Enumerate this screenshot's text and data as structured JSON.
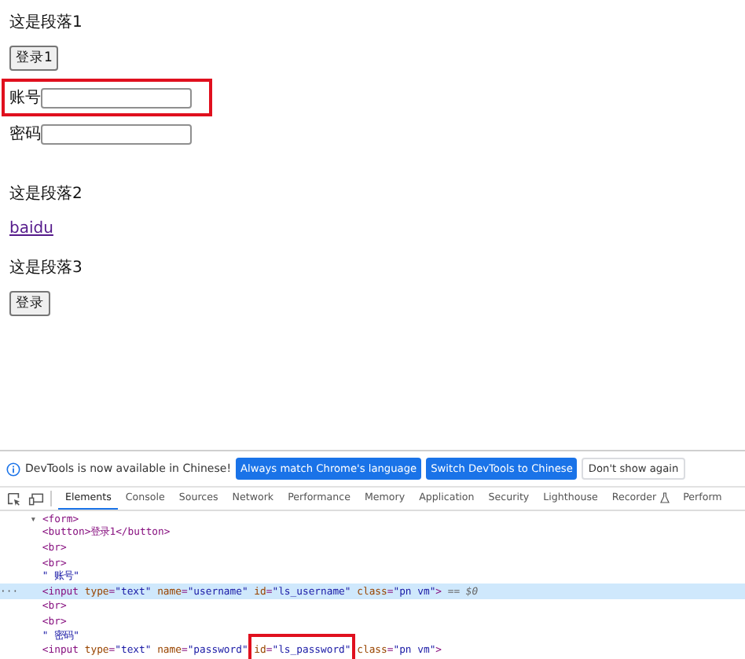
{
  "page": {
    "content": [
      {
        "kind": "paragraph",
        "text": "这是段落1"
      },
      {
        "kind": "button",
        "text": "登录1"
      },
      {
        "kind": "field",
        "label": "账号",
        "boxed": true
      },
      {
        "kind": "field",
        "label": "密码",
        "boxed": false
      },
      {
        "kind": "gap"
      },
      {
        "kind": "paragraph",
        "text": "这是段落2"
      },
      {
        "kind": "link",
        "text": "baidu"
      },
      {
        "kind": "paragraph",
        "text": "这是段落3"
      },
      {
        "kind": "button",
        "text": "登录"
      }
    ]
  },
  "devtools": {
    "infobar": {
      "message": "DevTools is now available in Chinese!",
      "buttons": [
        "Always match Chrome's language",
        "Switch DevTools to Chinese"
      ],
      "dismiss": "Don't show again"
    },
    "tabs": [
      {
        "label": "Elements",
        "selected": true
      },
      {
        "label": "Console",
        "selected": false
      },
      {
        "label": "Sources",
        "selected": false
      },
      {
        "label": "Network",
        "selected": false
      },
      {
        "label": "Performance",
        "selected": false
      },
      {
        "label": "Memory",
        "selected": false
      },
      {
        "label": "Application",
        "selected": false
      },
      {
        "label": "Security",
        "selected": false
      },
      {
        "label": "Lighthouse",
        "selected": false
      },
      {
        "label": "Recorder",
        "selected": false,
        "flask": true
      },
      {
        "label": "Perform",
        "selected": false
      }
    ],
    "tree": [
      {
        "expander": "▾",
        "parts": [
          {
            "text": "<form>",
            "boxed": false
          }
        ],
        "selected": false,
        "children": [
          {
            "parts": [
              {
                "text": "<button>登录1</button>",
                "boxed": false
              }
            ],
            "selected": false
          },
          {
            "parts": [
              {
                "text": "<br>",
                "boxed": false
              }
            ],
            "selected": false
          },
          {
            "parts": [
              {
                "text": "<br>",
                "boxed": false
              }
            ],
            "selected": false
          },
          {
            "parts": [
              {
                "text": "\" 账号\"",
                "boxed": false
              }
            ],
            "selected": false
          },
          {
            "parts": [
              {
                "text": "<input type=\"text\" name=\"username\" id=\"ls_username\" class=\"pn vm\">",
                "boxed": false
              }
            ],
            "suffix": "== $0",
            "gutter": "···",
            "selected": true
          },
          {
            "parts": [
              {
                "text": "<br>",
                "boxed": false
              }
            ],
            "selected": false
          },
          {
            "parts": [
              {
                "text": "<br>",
                "boxed": false
              }
            ],
            "selected": false
          },
          {
            "parts": [
              {
                "text": "\" 密码\"",
                "boxed": false
              }
            ],
            "selected": false
          },
          {
            "parts": [
              {
                "text": "<input type=\"text\" name=\"password\" ",
                "boxed": false
              },
              {
                "text": "id=\"ls_password\"",
                "boxed": true
              },
              {
                "text": " class=\"pn vm\">",
                "boxed": false
              }
            ],
            "selected": false
          }
        ]
      }
    ]
  }
}
